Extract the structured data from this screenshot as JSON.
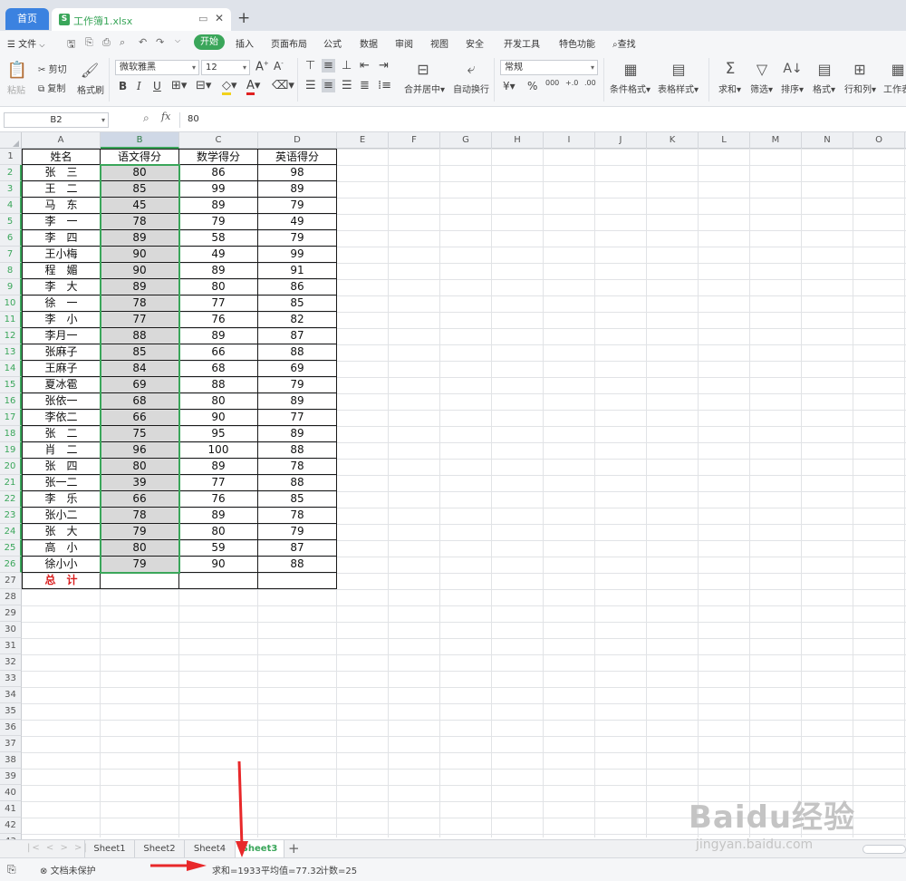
{
  "titlebar": {
    "home_tab": "首页",
    "file_icon": "S",
    "file_name": "工作簿1.xlsx"
  },
  "menu": {
    "file": "文件",
    "items": [
      "开始",
      "插入",
      "页面布局",
      "公式",
      "数据",
      "审阅",
      "视图",
      "安全",
      "开发工具",
      "特色功能"
    ],
    "search": "查找"
  },
  "toolbar": {
    "paste": "粘贴",
    "cut": "剪切",
    "copy": "复制",
    "format_painter": "格式刷",
    "font_name": "微软雅黑",
    "font_size": "12",
    "merge_center": "合并居中",
    "wrap_text": "自动换行",
    "number_format": "常规",
    "conditional_format": "条件格式",
    "table_style": "表格样式",
    "sum": "求和",
    "filter": "筛选",
    "sort": "排序",
    "format": "格式",
    "rows_cols": "行和列",
    "worksheet": "工作表"
  },
  "formula_bar": {
    "cell_ref": "B2",
    "fx": "fx",
    "value": "80"
  },
  "grid": {
    "columns": [
      "A",
      "B",
      "C",
      "D",
      "E",
      "F",
      "G",
      "H",
      "I",
      "J",
      "K",
      "L",
      "M",
      "N",
      "O"
    ],
    "row_count": 47,
    "headers": [
      "姓名",
      "语文得分",
      "数学得分",
      "英语得分"
    ],
    "rows": [
      [
        "张　三",
        "80",
        "86",
        "98"
      ],
      [
        "王　二",
        "85",
        "99",
        "89"
      ],
      [
        "马　东",
        "45",
        "89",
        "79"
      ],
      [
        "李　一",
        "78",
        "79",
        "49"
      ],
      [
        "李　四",
        "89",
        "58",
        "79"
      ],
      [
        "王小梅",
        "90",
        "49",
        "99"
      ],
      [
        "程　媚",
        "90",
        "89",
        "91"
      ],
      [
        "李　大",
        "89",
        "80",
        "86"
      ],
      [
        "徐　一",
        "78",
        "77",
        "85"
      ],
      [
        "李　小",
        "77",
        "76",
        "82"
      ],
      [
        "李月一",
        "88",
        "89",
        "87"
      ],
      [
        "张麻子",
        "85",
        "66",
        "88"
      ],
      [
        "王麻子",
        "84",
        "68",
        "69"
      ],
      [
        "夏冰雹",
        "69",
        "88",
        "79"
      ],
      [
        "张依一",
        "68",
        "80",
        "89"
      ],
      [
        "李依二",
        "66",
        "90",
        "77"
      ],
      [
        "张　二",
        "75",
        "95",
        "89"
      ],
      [
        "肖　二",
        "96",
        "100",
        "88"
      ],
      [
        "张　四",
        "80",
        "89",
        "78"
      ],
      [
        "张一二",
        "39",
        "77",
        "88"
      ],
      [
        "李　乐",
        "66",
        "76",
        "85"
      ],
      [
        "张小二",
        "78",
        "89",
        "78"
      ],
      [
        "张　大",
        "79",
        "80",
        "79"
      ],
      [
        "高　小",
        "80",
        "59",
        "87"
      ],
      [
        "徐小小",
        "79",
        "90",
        "88"
      ]
    ],
    "total_label": "总　计"
  },
  "sheets": {
    "tabs": [
      "Sheet1",
      "Sheet2",
      "Sheet4",
      "Sheet3"
    ],
    "active": "Sheet3"
  },
  "status": {
    "protect": "文档未保护",
    "sum": "求和=1933",
    "avg": "平均值=77.32",
    "count": "计数=25"
  },
  "watermark": {
    "logo": "Baidu经验",
    "url": "jingyan.baidu.com"
  },
  "colors": {
    "accent_green": "#3aa65a",
    "annotation_red": "#e8282a",
    "tab_blue": "#3b82e0",
    "total_red": "#d81e1e"
  }
}
